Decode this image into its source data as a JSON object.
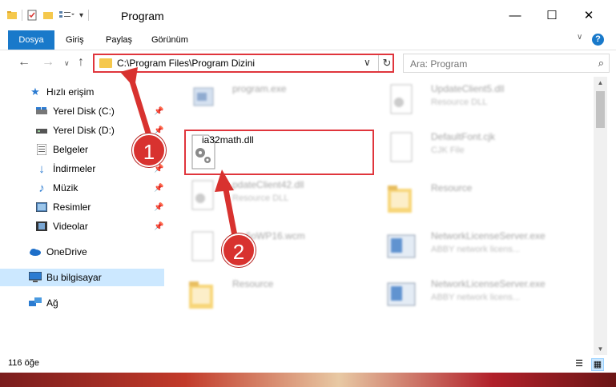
{
  "window": {
    "title": "Program",
    "minimize": "—",
    "maximize": "☐",
    "close": "✕"
  },
  "ribbon": {
    "tabs": [
      "Dosya",
      "Giriş",
      "Paylaş",
      "Görünüm"
    ],
    "help": "?"
  },
  "address": {
    "path": "C:\\Program Files\\Program Dizini"
  },
  "search": {
    "placeholder": "Ara: Program"
  },
  "sidebar": {
    "items": [
      {
        "label": "Hızlı erişim",
        "icon": "star-icon"
      },
      {
        "label": "Yerel Disk (C:)",
        "icon": "drive-icon"
      },
      {
        "label": "Yerel Disk (D:)",
        "icon": "drive-icon"
      },
      {
        "label": "Belgeler",
        "icon": "documents-icon"
      },
      {
        "label": "İndirmeler",
        "icon": "download-icon"
      },
      {
        "label": "Müzik",
        "icon": "music-icon"
      },
      {
        "label": "Resimler",
        "icon": "pictures-icon"
      },
      {
        "label": "Videolar",
        "icon": "video-icon"
      },
      {
        "label": "OneDrive",
        "icon": "cloud-icon"
      },
      {
        "label": "Bu bilgisayar",
        "icon": "computer-icon"
      },
      {
        "label": "Ağ",
        "icon": "network-icon"
      }
    ]
  },
  "files": [
    {
      "name": "program.exe",
      "type": ""
    },
    {
      "name": "UpdateClient5.dll",
      "type": "Resource DLL"
    },
    {
      "name": "ia32math.dll",
      "type": ""
    },
    {
      "name": "DefaultFont.cjk",
      "type": "CJK File"
    },
    {
      "name": "pdateClient42.dll",
      "type": "Resource DLL"
    },
    {
      "name": "Resource",
      "type": ""
    },
    {
      "name": "1...6oWP16.wcm",
      "type": "ile"
    },
    {
      "name": "NetworkLicenseServer.exe",
      "type": "ABBY network licens..."
    },
    {
      "name": "Resource",
      "type": ""
    },
    {
      "name": "NetworkLicenseServer.exe",
      "type": "ABBY network licens..."
    }
  ],
  "status": {
    "count": "116 öğe"
  },
  "annotations": {
    "step1": "1",
    "step2": "2"
  },
  "colors": {
    "accent": "#1979ca",
    "highlight": "#e0353c",
    "selection": "#cce8ff"
  }
}
